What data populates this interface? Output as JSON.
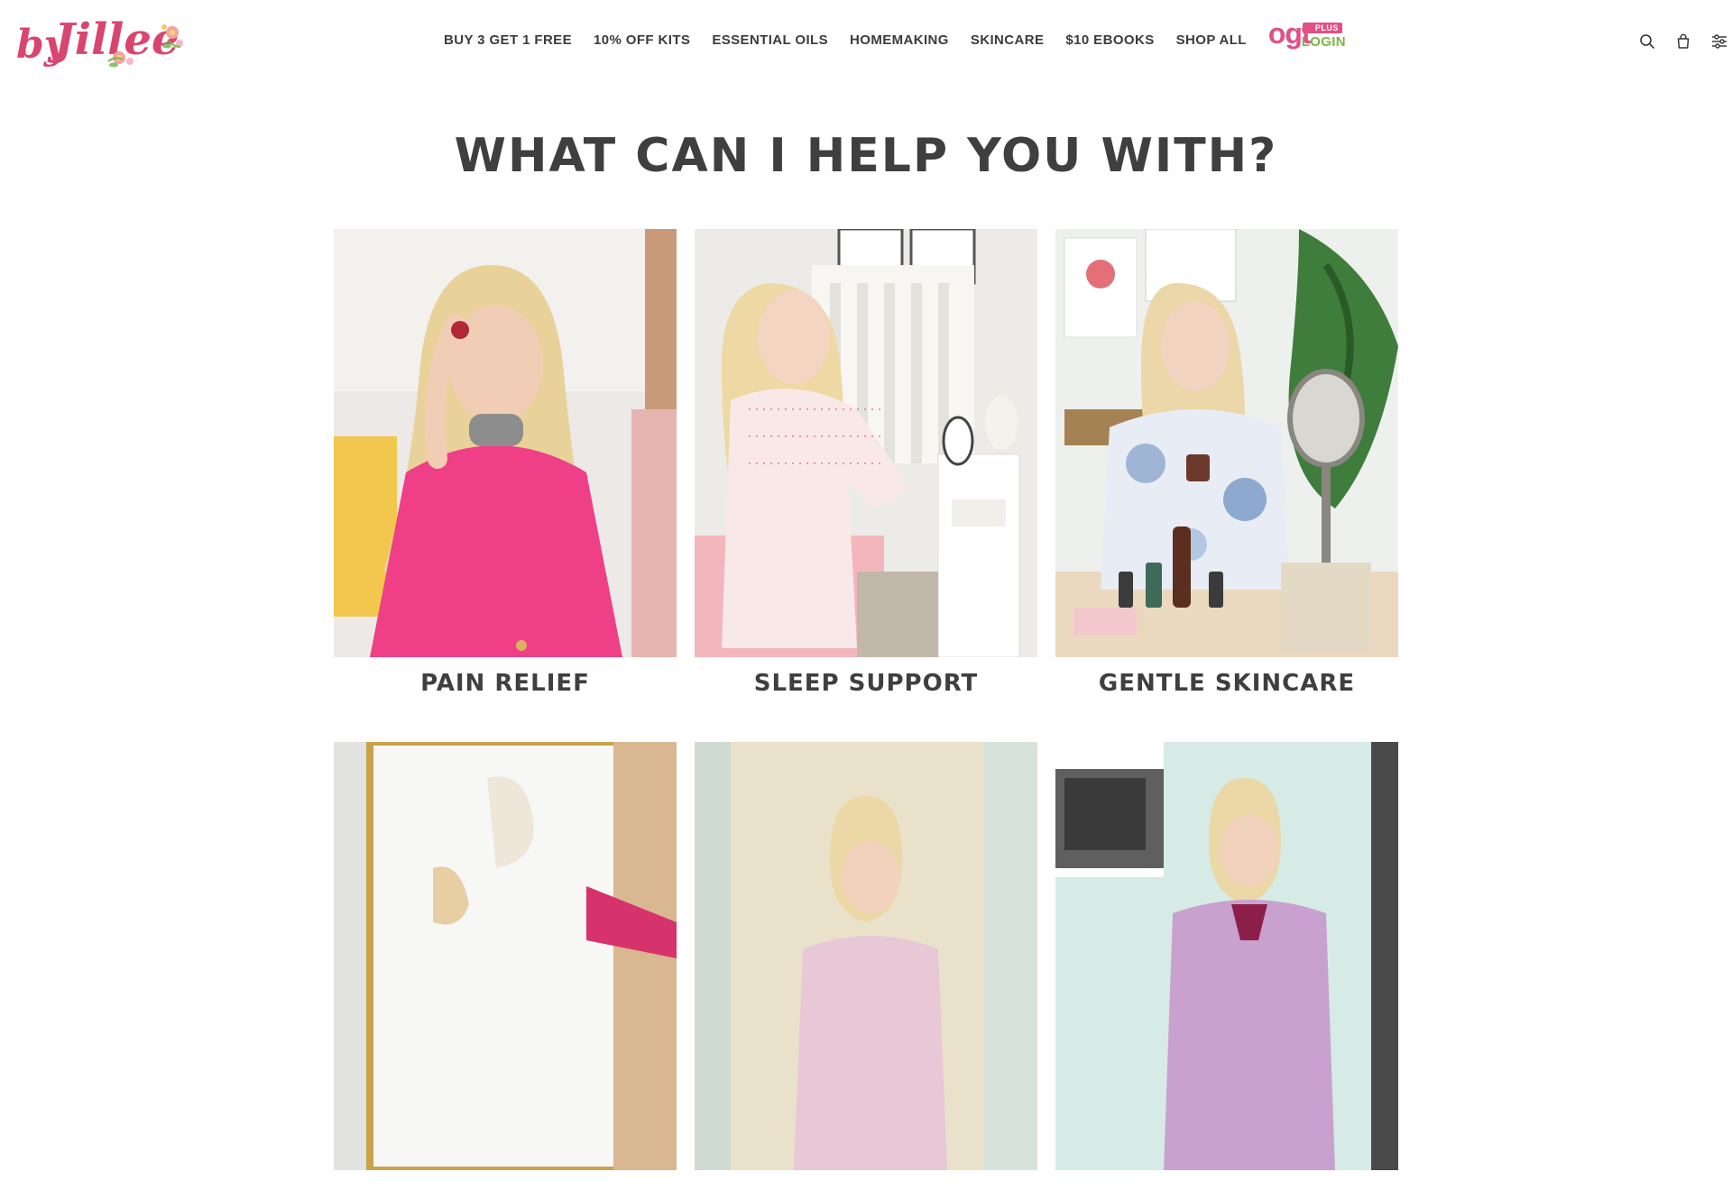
{
  "brand": {
    "logo_text": "by Jillee",
    "colors": {
      "pink": "#e14f86",
      "green": "#7ab648",
      "text": "#3f3f3f"
    }
  },
  "nav": {
    "items": [
      {
        "label": "BUY 3 GET 1 FREE"
      },
      {
        "label": "10% OFF KITS"
      },
      {
        "label": "ESSENTIAL OILS"
      },
      {
        "label": "HOMEMAKING"
      },
      {
        "label": "SKINCARE"
      },
      {
        "label": "$10 EBOOKS"
      },
      {
        "label": "SHOP ALL"
      }
    ],
    "ogt": {
      "word": "ogt",
      "badge": "PLUS",
      "login": "LOGIN"
    }
  },
  "header_icons": [
    "search-icon",
    "shopping-bag-icon",
    "filter-settings-icon"
  ],
  "main": {
    "title": "WHAT CAN I HELP YOU WITH?",
    "cards": [
      {
        "label": "PAIN RELIEF"
      },
      {
        "label": "SLEEP SUPPORT"
      },
      {
        "label": "GENTLE SKINCARE"
      },
      {
        "label": ""
      },
      {
        "label": ""
      },
      {
        "label": ""
      }
    ]
  }
}
